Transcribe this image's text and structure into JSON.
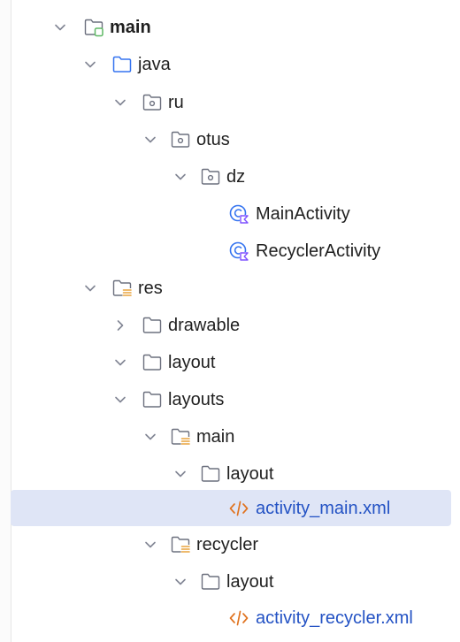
{
  "tree": {
    "items": [
      {
        "label": "main",
        "icon": "module-folder-icon",
        "expanded": true
      },
      {
        "label": "java",
        "icon": "source-folder-icon",
        "expanded": true
      },
      {
        "label": "ru",
        "icon": "package-icon",
        "expanded": true
      },
      {
        "label": "otus",
        "icon": "package-icon",
        "expanded": true
      },
      {
        "label": "dz",
        "icon": "package-icon",
        "expanded": true
      },
      {
        "label": "MainActivity",
        "icon": "kotlin-class-icon"
      },
      {
        "label": "RecyclerActivity",
        "icon": "kotlin-class-icon"
      },
      {
        "label": "res",
        "icon": "resource-folder-icon",
        "expanded": true
      },
      {
        "label": "drawable",
        "icon": "folder-icon",
        "expanded": false
      },
      {
        "label": "layout",
        "icon": "folder-icon",
        "expanded": true
      },
      {
        "label": "layouts",
        "icon": "folder-icon",
        "expanded": true
      },
      {
        "label": "main",
        "icon": "resource-folder-icon",
        "expanded": true
      },
      {
        "label": "layout",
        "icon": "folder-icon",
        "expanded": true
      },
      {
        "label": "activity_main.xml",
        "icon": "xml-file-icon",
        "selected": true
      },
      {
        "label": "recycler",
        "icon": "resource-folder-icon",
        "expanded": true
      },
      {
        "label": "layout",
        "icon": "folder-icon",
        "expanded": true
      },
      {
        "label": "activity_recycler.xml",
        "icon": "xml-file-icon"
      }
    ]
  },
  "colors": {
    "selection": "#dfe5f6",
    "source_folder": "#3574f0",
    "module_badge": "#5fb865",
    "resource_lines": "#e8a33d",
    "xml_icon": "#e0731f",
    "xml_text": "#2352c4",
    "kotlin_class": "#3574f0",
    "kotlin_badge": "#7f52ff"
  }
}
